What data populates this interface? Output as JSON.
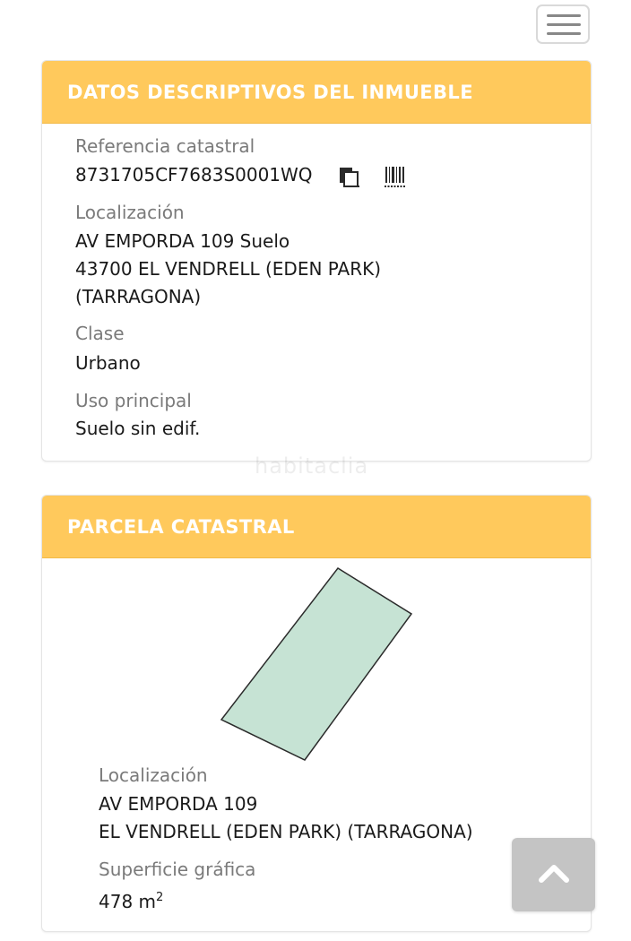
{
  "header": {
    "menu_icon": "hamburger-menu-icon"
  },
  "property_panel": {
    "title": "DATOS DESCRIPTIVOS DEL INMUEBLE",
    "reference_label": "Referencia catastral",
    "reference_value": "8731705CF7683S0001WQ",
    "copy_icon": "copy-icon",
    "barcode_icon": "barcode-icon",
    "location_label": "Localización",
    "location_line1": "AV EMPORDA 109 Suelo",
    "location_line2": "43700 EL VENDRELL (EDEN PARK)",
    "location_line3": "(TARRAGONA)",
    "class_label": "Clase",
    "class_value": "Urbano",
    "use_label": "Uso principal",
    "use_value": "Suelo sin edif."
  },
  "watermark": "habitaclia",
  "parcel_panel": {
    "title": "PARCELA CATASTRAL",
    "parcel_fill": "#c6e3d4",
    "location_label": "Localización",
    "location_line1": "AV EMPORDA 109",
    "location_line2": "EL VENDRELL (EDEN PARK) (TARRAGONA)",
    "area_label": "Superficie gráfica",
    "area_value": "478 m",
    "area_unit_sup": "2"
  },
  "scroll_top": {
    "icon": "chevron-up-icon"
  },
  "colors": {
    "panel_header": "#ffc95c",
    "panel_header_text": "#ffffff",
    "label_text": "#7a7a7a",
    "value_text": "#1a1a1a",
    "scroll_button": "#c4c4c4"
  }
}
